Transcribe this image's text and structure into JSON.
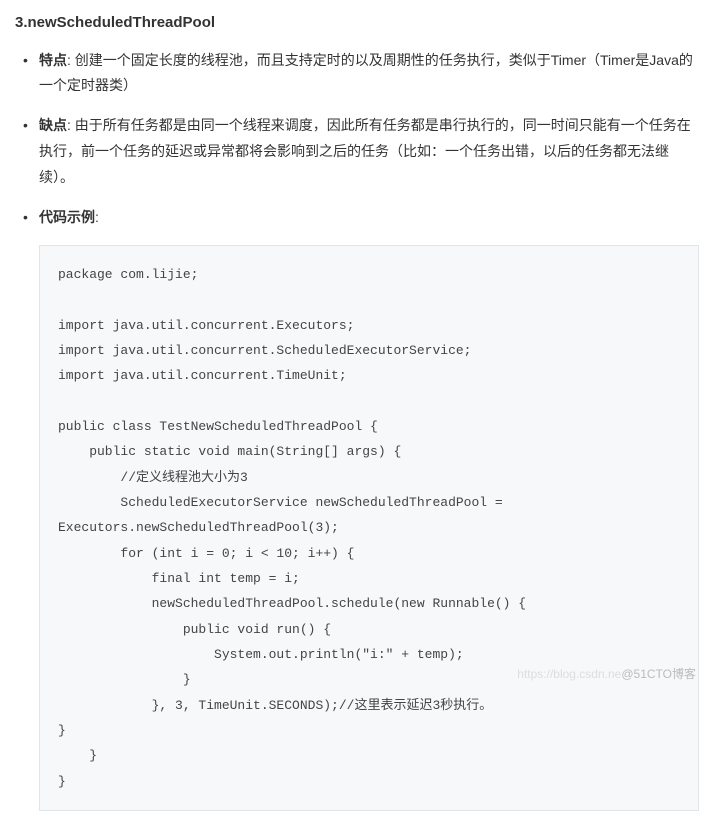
{
  "heading": "3.newScheduledThreadPool",
  "bullets": [
    {
      "label": "特点",
      "text": ": 创建一个固定长度的线程池，而且支持定时的以及周期性的任务执行，类似于Timer（Timer是Java的一个定时器类）"
    },
    {
      "label": "缺点",
      "text": ": 由于所有任务都是由同一个线程来调度，因此所有任务都是串行执行的，同一时间只能有一个任务在执行，前一个任务的延迟或异常都将会影响到之后的任务（比如：一个任务出错，以后的任务都无法继续）。"
    },
    {
      "label": "代码示例",
      "text": ":"
    }
  ],
  "code": "package com.lijie;\n\nimport java.util.concurrent.Executors;\nimport java.util.concurrent.ScheduledExecutorService;\nimport java.util.concurrent.TimeUnit;\n\npublic class TestNewScheduledThreadPool {\n    public static void main(String[] args) {\n        //定义线程池大小为3\n        ScheduledExecutorService newScheduledThreadPool = \nExecutors.newScheduledThreadPool(3);\n        for (int i = 0; i < 10; i++) {\n            final int temp = i;\n            newScheduledThreadPool.schedule(new Runnable() {\n                public void run() {\n                    System.out.println(\"i:\" + temp);\n                }\n            }, 3, TimeUnit.SECONDS);//这里表示延迟3秒执行。\n}\n    }\n}",
  "watermark_left": "https://blog.csdn.ne",
  "watermark_right": "@51CTO博客"
}
